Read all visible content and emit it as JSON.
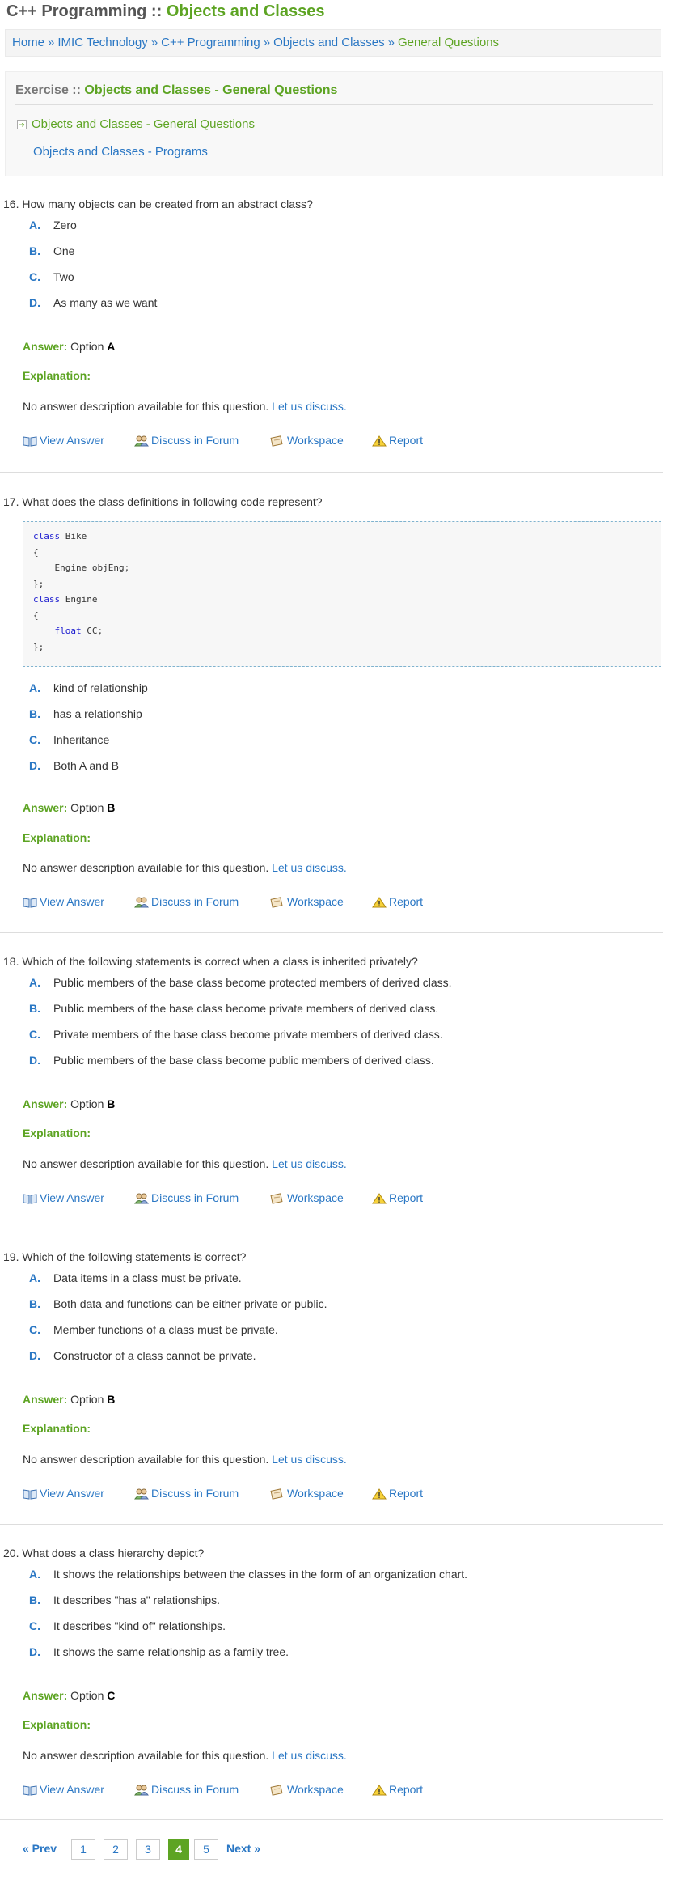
{
  "header": {
    "title_prefix": "C++ Programming :: ",
    "title_main": "Objects and Classes"
  },
  "breadcrumb": {
    "items": [
      "Home",
      "IMIC Technology",
      "C++ Programming",
      "Objects and Classes"
    ],
    "current": "General Questions",
    "separator": "»"
  },
  "exercise": {
    "prefix": "Exercise :: ",
    "title": "Objects and Classes - General Questions",
    "links": [
      "Objects and Classes - General Questions",
      "Objects and Classes - Programs"
    ]
  },
  "labels": {
    "answer": "Answer:",
    "option_word": "Option",
    "explanation": "Explanation:",
    "no_desc": "No answer description available for this question.",
    "discuss": "Let us discuss.",
    "view_answer": "View Answer",
    "discuss_forum": "Discuss in Forum",
    "workspace": "Workspace",
    "report": "Report"
  },
  "questions": [
    {
      "number": "16.",
      "text": "How many objects can be created from an abstract class?",
      "options": [
        {
          "letter": "A.",
          "text": "Zero"
        },
        {
          "letter": "B.",
          "text": "One"
        },
        {
          "letter": "C.",
          "text": "Two"
        },
        {
          "letter": "D.",
          "text": "As many as we want"
        }
      ],
      "answer": "A"
    },
    {
      "number": "17.",
      "text": "What does the class definitions in following code represent?",
      "code": [
        {
          "kw": "class",
          "rest": " Bike"
        },
        {
          "kw": "",
          "rest": "{"
        },
        {
          "kw": "",
          "rest": "    Engine objEng;"
        },
        {
          "kw": "",
          "rest": "};"
        },
        {
          "kw": "class",
          "rest": " Engine"
        },
        {
          "kw": "",
          "rest": "{"
        },
        {
          "kw": "    float",
          "rest": " CC;"
        },
        {
          "kw": "",
          "rest": "};"
        }
      ],
      "options": [
        {
          "letter": "A.",
          "text": "kind of relationship"
        },
        {
          "letter": "B.",
          "text": "has a relationship"
        },
        {
          "letter": "C.",
          "text": "Inheritance"
        },
        {
          "letter": "D.",
          "text": "Both A and B"
        }
      ],
      "answer": "B"
    },
    {
      "number": "18.",
      "text": "Which of the following statements is correct when a class is inherited privately?",
      "options": [
        {
          "letter": "A.",
          "text": "Public members of the base class become protected members of derived class."
        },
        {
          "letter": "B.",
          "text": "Public members of the base class become private members of derived class."
        },
        {
          "letter": "C.",
          "text": "Private members of the base class become private members of derived class."
        },
        {
          "letter": "D.",
          "text": "Public members of the base class become public members of derived class."
        }
      ],
      "answer": "B"
    },
    {
      "number": "19.",
      "text": "Which of the following statements is correct?",
      "options": [
        {
          "letter": "A.",
          "text": "Data items in a class must be private."
        },
        {
          "letter": "B.",
          "text": "Both data and functions can be either private or public."
        },
        {
          "letter": "C.",
          "text": "Member functions of a class must be private."
        },
        {
          "letter": "D.",
          "text": "Constructor of a class cannot be private."
        }
      ],
      "answer": "B"
    },
    {
      "number": "20.",
      "text": "What does a class hierarchy depict?",
      "options": [
        {
          "letter": "A.",
          "text": "It shows the relationships between the classes in the form of an organization chart."
        },
        {
          "letter": "B.",
          "text": "It describes \"has a\" relationships."
        },
        {
          "letter": "C.",
          "text": "It describes \"kind of\" relationships."
        },
        {
          "letter": "D.",
          "text": "It shows the same relationship as a family tree."
        }
      ],
      "answer": "C"
    }
  ],
  "pager": {
    "prev": "« Prev",
    "pages": [
      "1",
      "2",
      "3",
      "4",
      "5"
    ],
    "current": "4",
    "next": "Next »"
  },
  "colors": {
    "brand_green": "#5da423",
    "link_blue": "#2a77c4"
  },
  "icons": [
    "book-icon",
    "users-icon",
    "notepad-icon",
    "warning-icon",
    "arrow-right-icon"
  ]
}
